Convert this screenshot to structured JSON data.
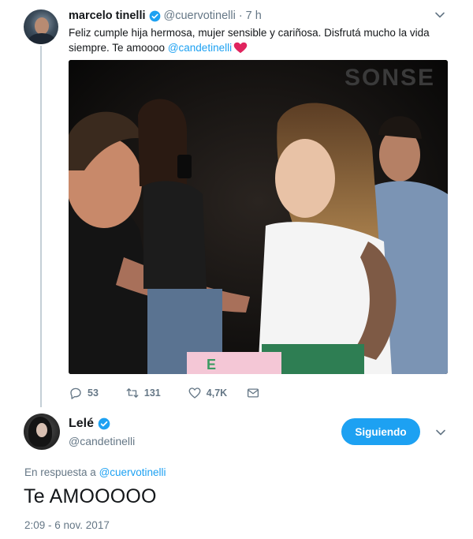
{
  "tweet1": {
    "display_name": "marcelo tinelli",
    "handle": "@cuervotinelli",
    "separator": "·",
    "time": "7 h",
    "text_line1": "Feliz cumple hija hermosa, mujer sensible y cariñosa. Disfrutá mucho la vida",
    "text_line2": "siempre. Te amoooo ",
    "mention": "@candetinelli",
    "heart_icon": "red-heart-emoji",
    "actions": {
      "replies": "53",
      "retweets": "131",
      "likes": "4,7K"
    }
  },
  "tweet2": {
    "display_name": "Lelé",
    "handle": "@candetinelli",
    "follow_label": "Siguiendo",
    "reply_prefix": "En respuesta a ",
    "reply_mention": "@cuervotinelli",
    "text": "Te AMOOOOO",
    "timestamp": "2:09 - 6 nov. 2017"
  },
  "colors": {
    "accent": "#1da1f2",
    "muted": "#657786",
    "heart": "#e0245e"
  }
}
